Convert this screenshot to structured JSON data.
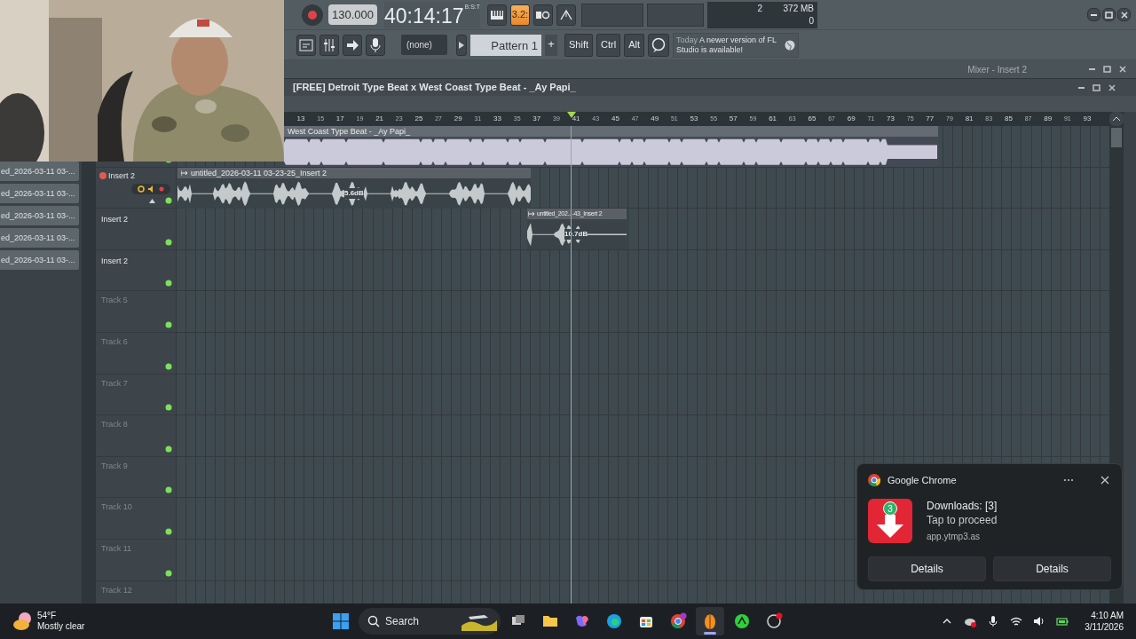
{
  "transport": {
    "tempo": "130.000",
    "time": "40:14:17",
    "time_format": "B:S:T",
    "tools": [
      {
        "kind": "keyboard",
        "selected": false
      },
      {
        "kind": "countdown",
        "label": "3.2:",
        "selected": true
      },
      {
        "kind": "loop",
        "selected": false
      },
      {
        "kind": "metronome",
        "selected": false
      }
    ],
    "monitor": {
      "value_1": "2",
      "memory": "372 MB",
      "value_2": "0"
    }
  },
  "toolbar": {
    "channel": "(none)",
    "pattern": "Pattern 1",
    "pattern_add": "+",
    "modifiers": [
      "Shift",
      "Ctrl",
      "Alt"
    ],
    "news": {
      "date": "Today",
      "text": "A newer version of FL Studio is available!"
    }
  },
  "mixer": {
    "title": "Mixer - Insert 2"
  },
  "playlist": {
    "title": "[FREE] Detroit Type Beat x West Coast Type Beat - _Ay Papi_",
    "ruler": [
      "13",
      "15",
      "17",
      "19",
      "21",
      "23",
      "25",
      "27",
      "29",
      "31",
      "33",
      "35",
      "37",
      "39",
      "41",
      "43",
      "45",
      "47",
      "49",
      "51",
      "53",
      "55",
      "57",
      "59",
      "61",
      "63",
      "65",
      "67",
      "69",
      "71",
      "73",
      "75",
      "77",
      "79",
      "81",
      "83",
      "85",
      "87",
      "89",
      "91",
      "93"
    ],
    "browser_items": [
      "ed_2026-03-11 03-...",
      "ed_2026-03-11 03-...",
      "ed_2026-03-11 03-...",
      "ed_2026-03-11 03-...",
      "ed_2026-03-11 03-..."
    ],
    "tracks": [
      {
        "name": "Insert 2",
        "kind": "expanded",
        "empty": false
      },
      {
        "name": "Insert 2",
        "kind": "plain",
        "empty": false
      },
      {
        "name": "Insert 2",
        "kind": "plain",
        "empty": false
      },
      {
        "name": "Track 5",
        "kind": "plain",
        "empty": true
      },
      {
        "name": "Track 6",
        "kind": "plain",
        "empty": true
      },
      {
        "name": "Track 7",
        "kind": "plain",
        "empty": true
      },
      {
        "name": "Track 8",
        "kind": "plain",
        "empty": true
      },
      {
        "name": "Track 9",
        "kind": "plain",
        "empty": true
      },
      {
        "name": "Track 10",
        "kind": "plain",
        "empty": true
      },
      {
        "name": "Track 11",
        "kind": "plain",
        "empty": true
      },
      {
        "name": "Track 12",
        "kind": "plain",
        "empty": true
      }
    ],
    "clips": [
      {
        "kind": "sample",
        "name": "West Coast Type Beat - _Ay Papi_"
      },
      {
        "kind": "recording",
        "name": "untitled_2026-03-11 03-23-25_Insert 2",
        "gain": "5.6dB"
      },
      {
        "kind": "recording",
        "name": "untitled_202...-43_Insert 2",
        "gain": "10.7dB"
      }
    ]
  },
  "notification": {
    "app": "Google Chrome",
    "badge": "3",
    "title": "Downloads: [3]",
    "body": "Tap to proceed",
    "source": "app.ytmp3.as",
    "actions": [
      "Details",
      "Details"
    ]
  },
  "taskbar": {
    "weather": {
      "temp": "54°F",
      "condition": "Mostly clear"
    },
    "search": {
      "placeholder": "Search"
    },
    "apps": [
      {
        "kind": "taskview",
        "selected": false
      },
      {
        "kind": "folder",
        "selected": false
      },
      {
        "kind": "copilot",
        "selected": false
      },
      {
        "kind": "edge",
        "selected": false
      },
      {
        "kind": "store",
        "selected": false
      },
      {
        "kind": "chrome",
        "selected": false
      },
      {
        "kind": "flstudio",
        "selected": true
      },
      {
        "kind": "greenapp",
        "selected": false
      },
      {
        "kind": "ringapp",
        "selected": false
      }
    ],
    "clock": {
      "time": "4:10 AM",
      "date": "3/11/2026"
    }
  }
}
